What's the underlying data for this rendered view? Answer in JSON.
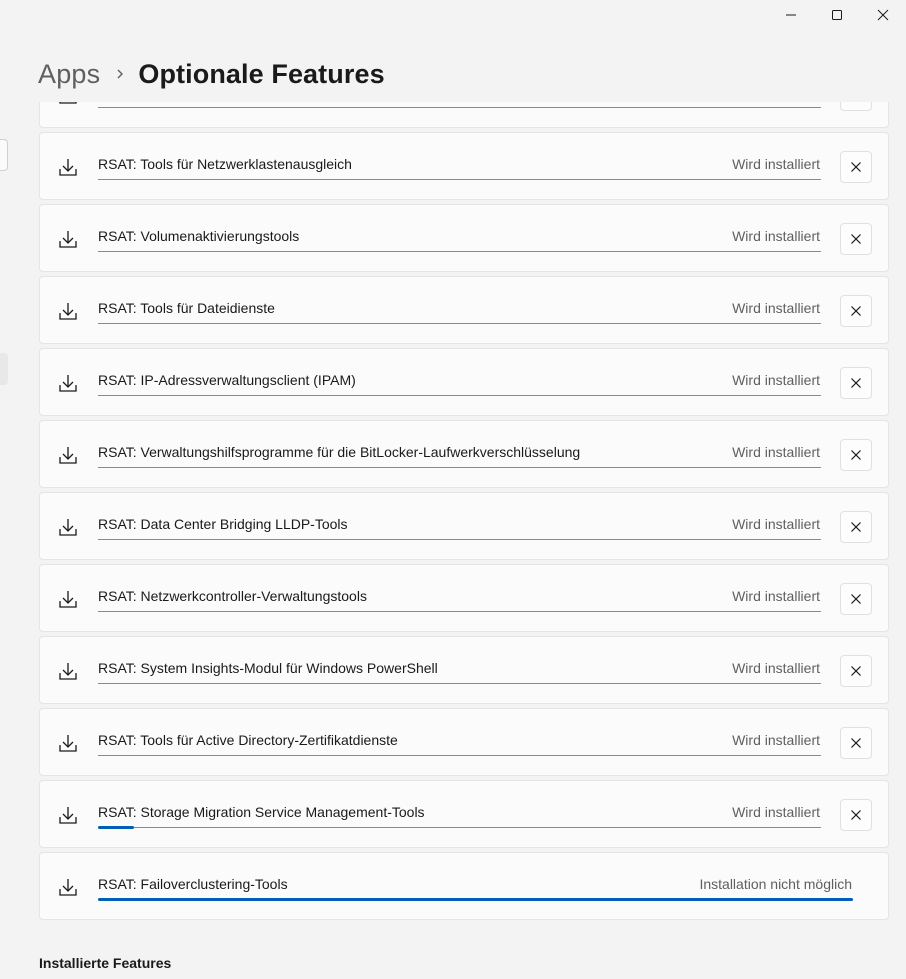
{
  "window": {
    "minimize_icon": "minimize-icon",
    "maximize_icon": "maximize-icon",
    "close_icon": "close-icon"
  },
  "breadcrumb": {
    "parent": "Apps",
    "separator_icon": "chevron-right-icon",
    "current": "Optionale Features"
  },
  "accent_color": "#005fb8",
  "features": [
    {
      "name": "",
      "status": "",
      "progress": 0,
      "cancelable": true
    },
    {
      "name": "RSAT: Tools für Netzwerklastenausgleich",
      "status": "Wird installiert",
      "progress": 0,
      "cancelable": true
    },
    {
      "name": "RSAT: Volumenaktivierungstools",
      "status": "Wird installiert",
      "progress": 0,
      "cancelable": true
    },
    {
      "name": "RSAT: Tools für Dateidienste",
      "status": "Wird installiert",
      "progress": 0,
      "cancelable": true
    },
    {
      "name": "RSAT: IP-Adressverwaltungsclient (IPAM)",
      "status": "Wird installiert",
      "progress": 0,
      "cancelable": true
    },
    {
      "name": "RSAT: Verwaltungshilfsprogramme für die BitLocker-Laufwerkverschlüsselung",
      "status": "Wird installiert",
      "progress": 0,
      "cancelable": true
    },
    {
      "name": "RSAT: Data Center Bridging LLDP-Tools",
      "status": "Wird installiert",
      "progress": 0,
      "cancelable": true
    },
    {
      "name": "RSAT: Netzwerkcontroller-Verwaltungstools",
      "status": "Wird installiert",
      "progress": 0,
      "cancelable": true
    },
    {
      "name": "RSAT: System Insights-Modul für Windows PowerShell",
      "status": "Wird installiert",
      "progress": 0,
      "cancelable": true
    },
    {
      "name": "RSAT: Tools für Active Directory-Zertifikatdienste",
      "status": "Wird installiert",
      "progress": 0,
      "cancelable": true
    },
    {
      "name": "RSAT: Storage Migration Service Management-Tools",
      "status": "Wird installiert",
      "progress": 0.05,
      "cancelable": true
    },
    {
      "name": "RSAT: Failoverclustering-Tools",
      "status": "Installation nicht möglich",
      "progress": 1,
      "cancelable": false
    }
  ],
  "installed_section": {
    "title": "Installierte Features"
  }
}
